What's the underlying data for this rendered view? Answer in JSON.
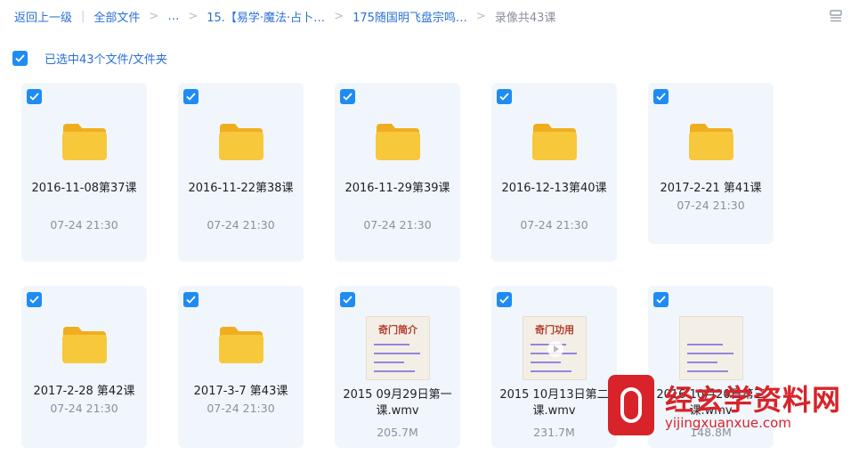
{
  "breadcrumb": {
    "back": "返回上一级",
    "all_files": "全部文件",
    "ellipsis": "…",
    "level1": "15.【易学·魔法·占卜…",
    "level2": "175随国明飞盘宗鸣…",
    "current": "录像共43课",
    "sep": ">",
    "bar": "|"
  },
  "selection": {
    "label": "已选中43个文件/文件夹"
  },
  "items": [
    {
      "name": "2016-11-08第37课",
      "meta": "07-24 21:30",
      "type": "folder"
    },
    {
      "name": "2016-11-22第38课",
      "meta": "07-24 21:30",
      "type": "folder"
    },
    {
      "name": "2016-11-29第39课",
      "meta": "07-24 21:30",
      "type": "folder"
    },
    {
      "name": "2016-12-13第40课",
      "meta": "07-24 21:30",
      "type": "folder"
    },
    {
      "name": "2017-2-21 第41课",
      "meta": "07-24 21:30",
      "type": "folder"
    },
    {
      "name": "2017-2-28 第42课",
      "meta": "07-24 21:30",
      "type": "folder"
    },
    {
      "name": "2017-3-7 第43课",
      "meta": "07-24 21:30",
      "type": "folder"
    },
    {
      "name": "2015 09月29日第一课.wmv",
      "meta": "205.7M",
      "type": "video",
      "thumb_title": "奇门简介"
    },
    {
      "name": "2015 10月13日第二课.wmv",
      "meta": "231.7M",
      "type": "video",
      "thumb_title": "奇门功用"
    },
    {
      "name": "2016 10月20日第三课.wmv",
      "meta": "148.8M",
      "type": "video",
      "thumb_title": ""
    }
  ],
  "watermark": {
    "cn": "经玄学资料网",
    "url": "yijingxuanxue.com"
  },
  "colors": {
    "accent": "#1f8cf4",
    "link": "#2a6fd6",
    "card_bg": "#f1f6fd",
    "folder": "#f7c43a",
    "watermark": "#d8232a"
  },
  "icons": {
    "folder": "folder-icon",
    "check": "check-icon",
    "view": "list-view-icon"
  }
}
